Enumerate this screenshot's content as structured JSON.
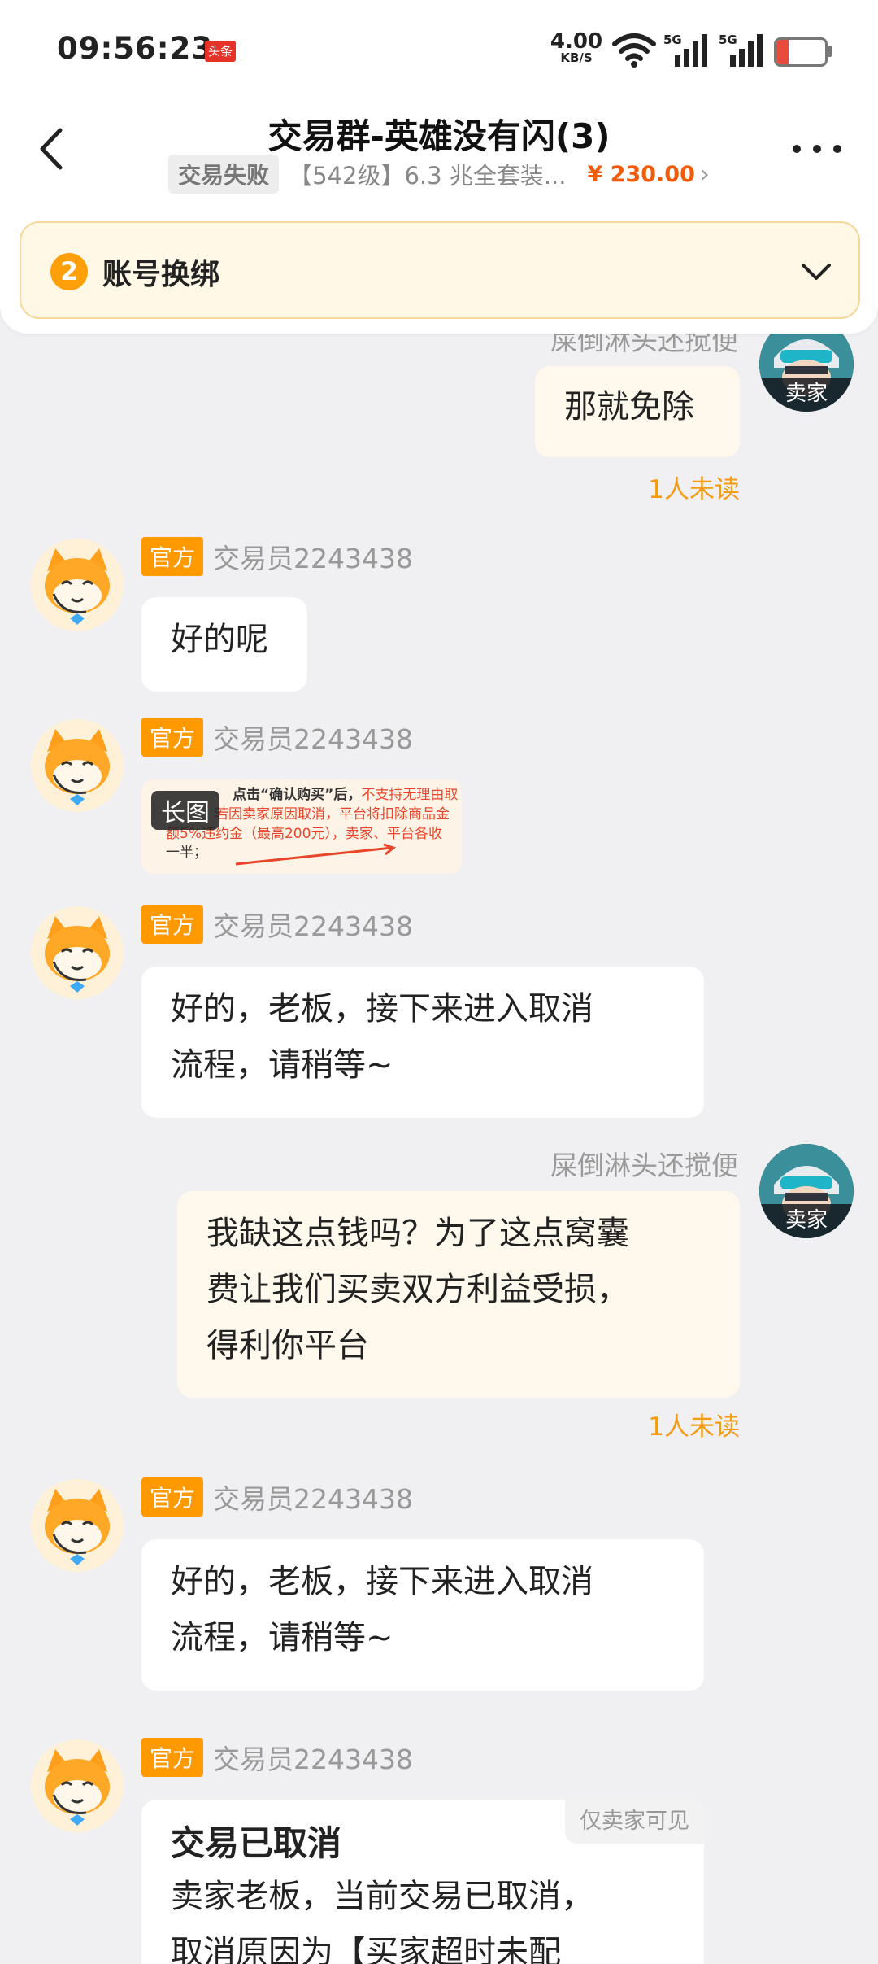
{
  "status_bar": {
    "time": "09:56:23",
    "notif_badge": "头条",
    "net_speed": "4.00",
    "net_unit": "KB/S",
    "sig1_label": "5G",
    "sig2_label": "5G",
    "battery": "14",
    "battery_level_percent": 14
  },
  "header": {
    "title": "交易群-英雄没有闪(3)",
    "order_status": "交易失败",
    "order_desc": "【542级】6.3 兆全套装...",
    "order_price": "¥ 230.00",
    "step_num": "2",
    "step_label": "账号换绑"
  },
  "messages": {
    "m0": {
      "sender": "屎倒淋头还搅便",
      "text": "那就免除",
      "unread": "1人未读",
      "avatar_tag": "卖家"
    },
    "m1": {
      "badge": "官方",
      "sender": "交易员2243438",
      "text": "好的呢"
    },
    "m2": {
      "badge": "官方",
      "sender": "交易员2243438",
      "long_tag": "长图",
      "img_line1a": "点击“确认购买”后，",
      "img_line1b": "不支持无理由取",
      "img_line2": "若因卖家原因取消，平台将扣除商品金",
      "img_line3": "额5%违约金（最高200元），卖家、平台各收",
      "img_line4": "一半；"
    },
    "m3": {
      "badge": "官方",
      "sender": "交易员2243438",
      "text_l1": "好的，老板，接下来进入取消",
      "text_l2": "流程，请稍等~"
    },
    "m4": {
      "sender": "屎倒淋头还搅便",
      "avatar_tag": "卖家",
      "text_l1": "我缺这点钱吗？为了这点窝囊",
      "text_l2": "费让我们买卖双方利益受损，",
      "text_l3": "得利你平台",
      "unread": "1人未读"
    },
    "m5": {
      "badge": "官方",
      "sender": "交易员2243438",
      "text_l1": "好的，老板，接下来进入取消",
      "text_l2": "流程，请稍等~"
    },
    "m6": {
      "badge": "官方",
      "sender": "交易员2243438",
      "corner_tag": "仅卖家可见",
      "title": "交易已取消",
      "text_l1": "卖家老板，当前交易已取消，",
      "text_l2": "取消原因为【买家超时未配"
    }
  },
  "colors": {
    "accent_orange": "#ff9900",
    "price_orange": "#f25b0a",
    "unread_orange": "#f39c12",
    "my_bubble": "#fff8ec",
    "page_bg": "#f0f0f2"
  }
}
